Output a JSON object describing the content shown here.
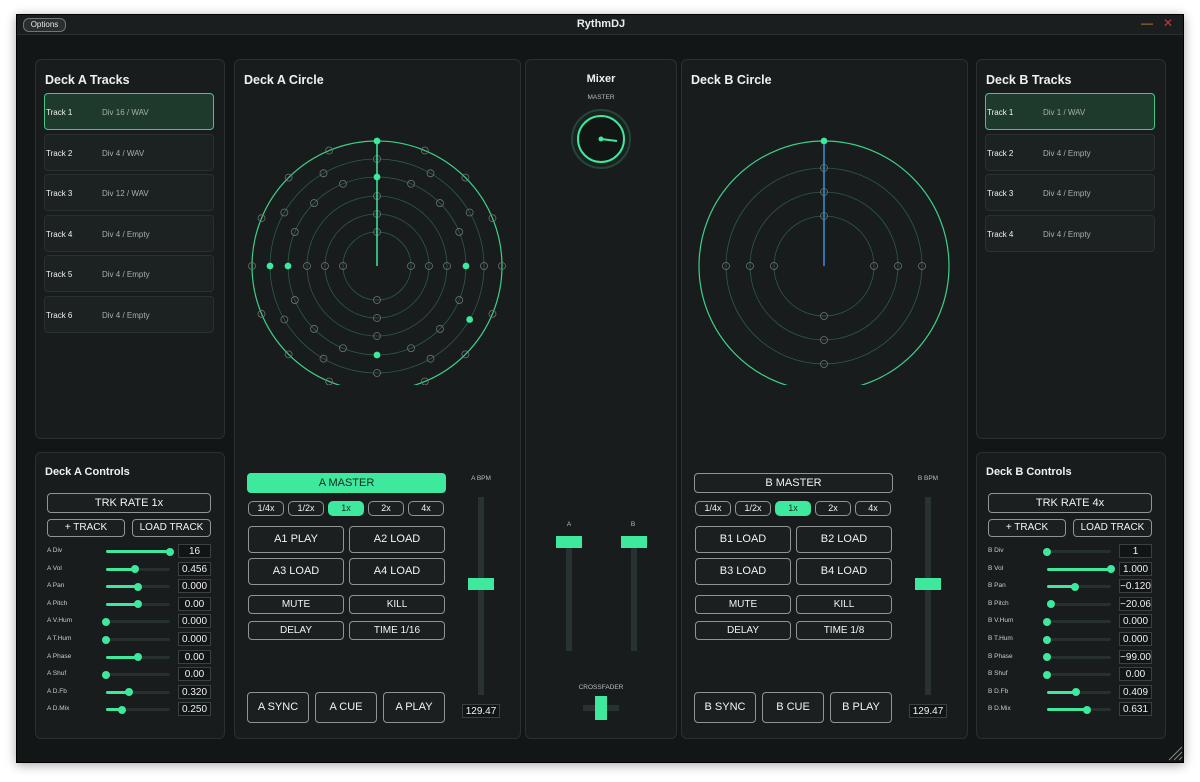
{
  "window": {
    "title": "RythmDJ",
    "options_label": "Options",
    "minimize_icon": "minimize-icon",
    "close_icon": "close-icon"
  },
  "colors": {
    "accent": "#3ee89c",
    "background": "#131617",
    "panel": "#181c1d",
    "blue_hand": "#3a8fe0"
  },
  "deckA": {
    "tracks_title": "Deck A Tracks",
    "tracks": [
      {
        "name": "Track 1",
        "detail": "Div 16 / WAV",
        "selected": true
      },
      {
        "name": "Track 2",
        "detail": "Div 4 / WAV",
        "selected": false
      },
      {
        "name": "Track 3",
        "detail": "Div 12 / WAV",
        "selected": false
      },
      {
        "name": "Track 4",
        "detail": "Div 4 / Empty",
        "selected": false
      },
      {
        "name": "Track 5",
        "detail": "Div 4 / Empty",
        "selected": false
      },
      {
        "name": "Track 6",
        "detail": "Div 4 / Empty",
        "selected": false
      }
    ],
    "circle_title": "Deck A Circle",
    "controls_title": "Deck A Controls",
    "trk_rate": "TRK RATE 1x",
    "add_track": "+ TRACK",
    "load_track": "LOAD TRACK",
    "params": [
      {
        "label": "A Div",
        "value": "16",
        "level": 1.0
      },
      {
        "label": "A Vol",
        "value": "0.456",
        "level": 0.456
      },
      {
        "label": "A Pan",
        "value": "0.000",
        "level": 0.5
      },
      {
        "label": "A Pitch",
        "value": "0.00",
        "level": 0.5
      },
      {
        "label": "A V.Hum",
        "value": "0.000",
        "level": 0.0
      },
      {
        "label": "A T.Hum",
        "value": "0.000",
        "level": 0.0
      },
      {
        "label": "A Phase",
        "value": "0.00",
        "level": 0.5
      },
      {
        "label": "A Shuf",
        "value": "0.00",
        "level": 0.0
      },
      {
        "label": "A D.Fb",
        "value": "0.320",
        "level": 0.36
      },
      {
        "label": "A D.Mix",
        "value": "0.250",
        "level": 0.25
      }
    ],
    "master_label": "A MASTER",
    "master_active": true,
    "rates": [
      "1/4x",
      "1/2x",
      "1x",
      "2x",
      "4x"
    ],
    "active_rate": 2,
    "pads": [
      "A1 PLAY",
      "A2 LOAD",
      "A3 LOAD",
      "A4 LOAD"
    ],
    "fx": [
      "MUTE",
      "KILL",
      "DELAY",
      "TIME 1/16"
    ],
    "transport": [
      "A SYNC",
      "A CUE",
      "A PLAY"
    ],
    "bpm_label": "A BPM",
    "bpm_value": "129.47",
    "bpm_level": 0.44
  },
  "deckB": {
    "tracks_title": "Deck B Tracks",
    "tracks": [
      {
        "name": "Track 1",
        "detail": "Div 1 / WAV",
        "selected": true
      },
      {
        "name": "Track 2",
        "detail": "Div 4 / Empty",
        "selected": false
      },
      {
        "name": "Track 3",
        "detail": "Div 4 / Empty",
        "selected": false
      },
      {
        "name": "Track 4",
        "detail": "Div 4 / Empty",
        "selected": false
      }
    ],
    "circle_title": "Deck B Circle",
    "controls_title": "Deck B Controls",
    "trk_rate": "TRK RATE 4x",
    "add_track": "+ TRACK",
    "load_track": "LOAD TRACK",
    "params": [
      {
        "label": "B Div",
        "value": "1",
        "level": 0.0
      },
      {
        "label": "B Vol",
        "value": "1.000",
        "level": 1.0
      },
      {
        "label": "B Pan",
        "value": "−0.120",
        "level": 0.44
      },
      {
        "label": "B Pitch",
        "value": "−20.06",
        "level": 0.06
      },
      {
        "label": "B V.Hum",
        "value": "0.000",
        "level": 0.0
      },
      {
        "label": "B T.Hum",
        "value": "0.000",
        "level": 0.0
      },
      {
        "label": "B Phase",
        "value": "−99.00",
        "level": 0.0
      },
      {
        "label": "B Shuf",
        "value": "0.00",
        "level": 0.0
      },
      {
        "label": "B D.Fb",
        "value": "0.409",
        "level": 0.46
      },
      {
        "label": "B D.Mix",
        "value": "0.631",
        "level": 0.63
      }
    ],
    "master_label": "B MASTER",
    "master_active": false,
    "rates": [
      "1/4x",
      "1/2x",
      "1x",
      "2x",
      "4x"
    ],
    "active_rate": 2,
    "pads": [
      "B1 LOAD",
      "B2 LOAD",
      "B3 LOAD",
      "B4 LOAD"
    ],
    "fx": [
      "MUTE",
      "KILL",
      "DELAY",
      "TIME 1/8"
    ],
    "transport": [
      "B SYNC",
      "B CUE",
      "B PLAY"
    ],
    "bpm_label": "B BPM",
    "bpm_value": "129.47",
    "bpm_level": 0.44
  },
  "mixer": {
    "title": "Mixer",
    "master_label": "MASTER",
    "channel_a_label": "A",
    "channel_b_label": "B",
    "channel_a_level": 1.0,
    "channel_b_level": 1.0,
    "crossfader_label": "CROSSFADER",
    "crossfader_position": 0.5
  }
}
